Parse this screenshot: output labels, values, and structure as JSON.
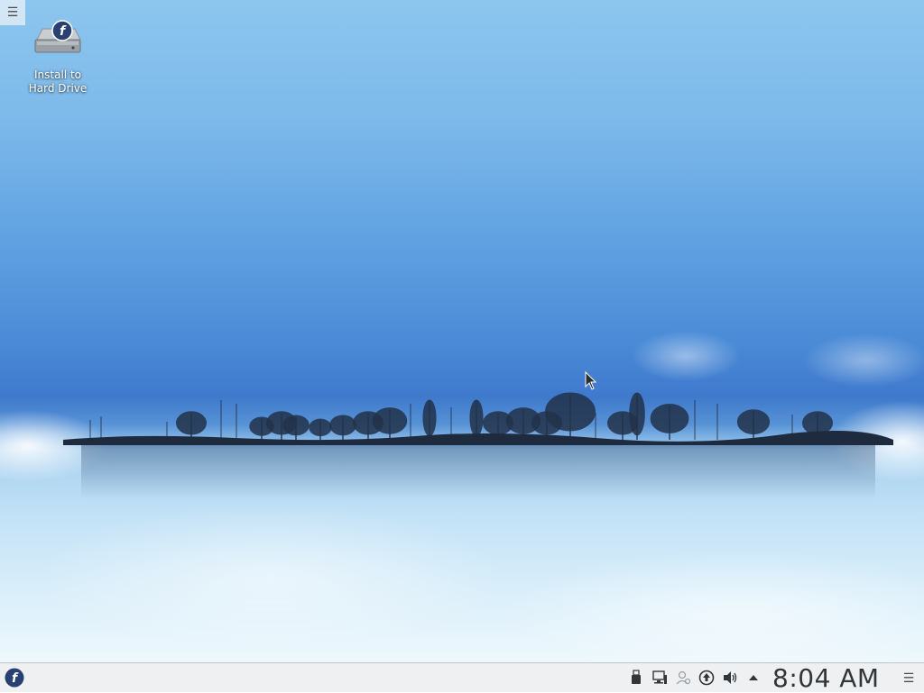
{
  "desktop": {
    "toolbox_icon": "hamburger-menu-icon",
    "icons": [
      {
        "label": "Install to\nHard Drive",
        "icon": "fedora-hard-drive-icon"
      }
    ]
  },
  "panel": {
    "launcher_icon": "fedora-logo-icon",
    "tray": [
      {
        "name": "usb-device-notifier-icon"
      },
      {
        "name": "network-monitor-icon"
      },
      {
        "name": "user-switcher-icon"
      },
      {
        "name": "software-updates-icon"
      },
      {
        "name": "volume-icon"
      },
      {
        "name": "show-hidden-icons-arrow-icon"
      }
    ],
    "clock": "8:04 AM",
    "menu_icon": "panel-options-icon"
  },
  "colors": {
    "panel_bg": "#eff0f1",
    "fedora_blue": "#294172",
    "sky_blue": "#4a8ad6"
  }
}
